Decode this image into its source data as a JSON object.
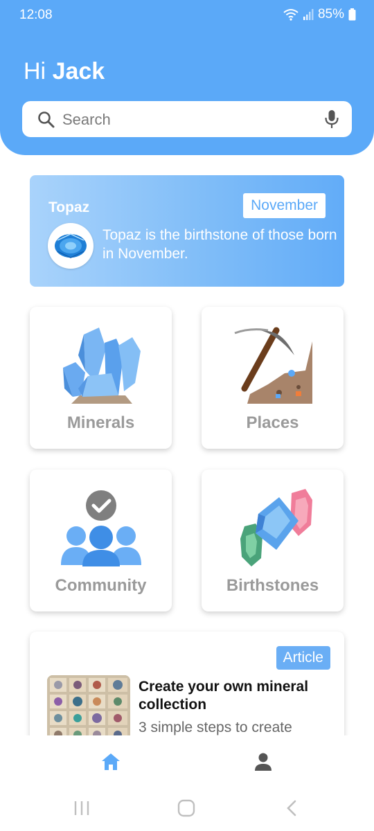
{
  "status_bar": {
    "time": "12:08",
    "battery": "85%"
  },
  "header": {
    "greeting_prefix": "Hi",
    "user_name": "Jack"
  },
  "search": {
    "placeholder": "Search"
  },
  "birthstone_card": {
    "title": "Topaz",
    "month": "November",
    "description": "Topaz is the birthstone of those born in November."
  },
  "tiles": [
    {
      "label": "Minerals",
      "icon": "crystal-icon"
    },
    {
      "label": "Places",
      "icon": "pickaxe-icon"
    },
    {
      "label": "Community",
      "icon": "community-icon"
    },
    {
      "label": "Birthstones",
      "icon": "gems-icon"
    }
  ],
  "article": {
    "badge": "Article",
    "title": "Create your own mineral collection",
    "subtitle": "3 simple steps to create"
  },
  "bottom_nav": {
    "items": [
      "home-icon",
      "profile-icon"
    ],
    "active_color": "#5ba9f8",
    "inactive_color": "#555555"
  },
  "colors": {
    "primary": "#5ba9f8",
    "tile_label": "#9a9a9a"
  }
}
